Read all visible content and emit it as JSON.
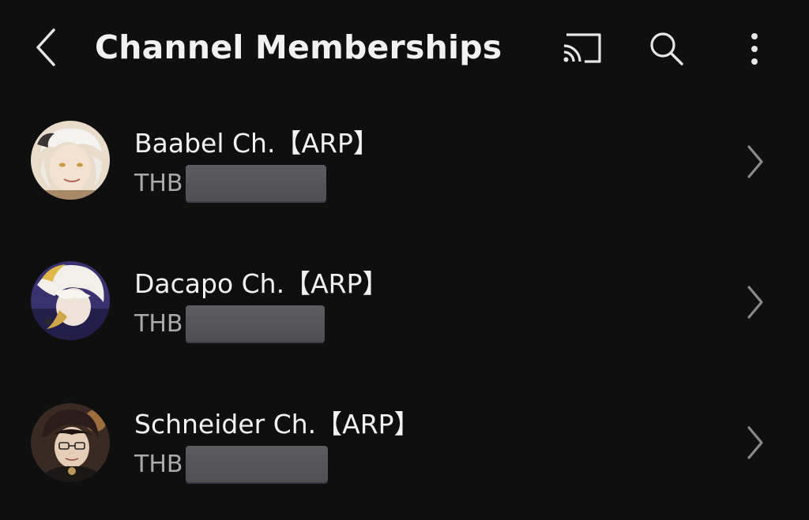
{
  "header": {
    "title": "Channel Memberships",
    "back_icon": "chevron-left-icon",
    "cast_icon": "cast-icon",
    "search_icon": "search-icon",
    "more_icon": "more-vertical-icon"
  },
  "memberships": [
    {
      "channel_name": "Baabel Ch.【ARP】",
      "currency": "THB",
      "price_redacted": true
    },
    {
      "channel_name": "Dacapo Ch.【ARP】",
      "currency": "THB",
      "price_redacted": true
    },
    {
      "channel_name": "Schneider Ch.【ARP】",
      "currency": "THB",
      "price_redacted": true
    }
  ],
  "colors": {
    "background": "#0f0f0f",
    "primary_text": "#f1f1f1",
    "secondary_text": "#aaaaaa",
    "icon": "#e6e6e6",
    "chevron": "#8a8a8a",
    "redaction": "#56565a"
  }
}
